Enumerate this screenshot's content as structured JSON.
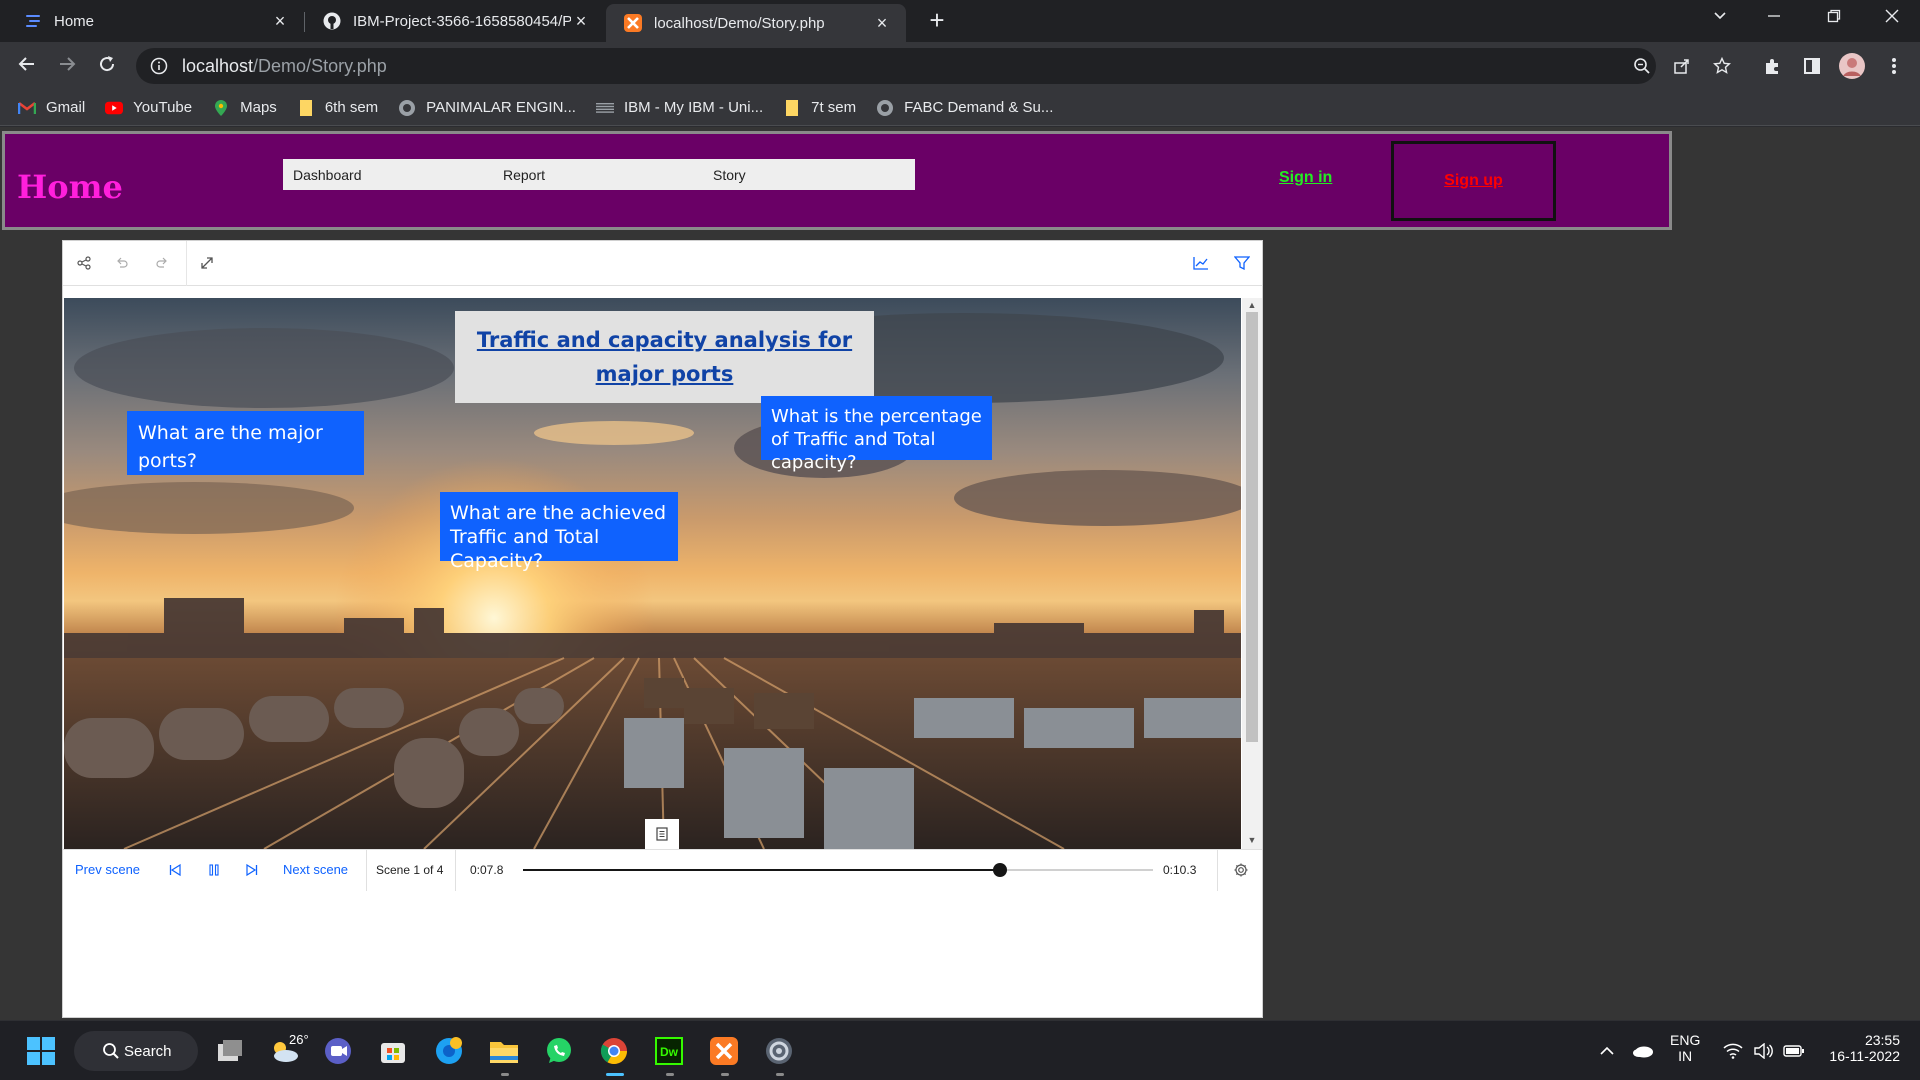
{
  "browser": {
    "tabs": [
      {
        "title": "Home",
        "close": "×"
      },
      {
        "title": "IBM-Project-3566-1658580454/P",
        "close": "×"
      },
      {
        "title": "localhost/Demo/Story.php",
        "close": "×"
      }
    ],
    "new_tab": "+",
    "address": {
      "host": "localhost",
      "path": "/Demo/Story.php"
    },
    "bookmarks": [
      {
        "label": "Gmail"
      },
      {
        "label": "YouTube"
      },
      {
        "label": "Maps"
      },
      {
        "label": "6th sem"
      },
      {
        "label": "PANIMALAR ENGIN..."
      },
      {
        "label": "IBM - My IBM - Uni..."
      },
      {
        "label": "7t sem"
      },
      {
        "label": "FABC Demand & Su..."
      }
    ]
  },
  "site": {
    "brand": "Home",
    "menu": [
      "Dashboard",
      "Report",
      "Story"
    ],
    "signin": "Sign in",
    "signup": "Sign up"
  },
  "story": {
    "title_card": "Traffic and capacity analysis for major ports",
    "questions": [
      "What are the major ports?",
      "What is the percentage of Traffic and Total capacity?",
      "What are the  achieved Traffic and Total Capacity?"
    ],
    "controls": {
      "prev": "Prev scene",
      "next": "Next scene",
      "scene_counter": "Scene 1 of 4",
      "elapsed": "0:07.8",
      "total": "0:10.3",
      "progress_fraction": 0.757
    }
  },
  "taskbar": {
    "search": "Search",
    "weather_temp": "26°",
    "lang_top": "ENG",
    "lang_bottom": "IN",
    "time": "23:55",
    "date": "16-11-2022"
  },
  "colors": {
    "header_bg": "#6a0066",
    "brand": "#ff1fdc",
    "signin": "#22ee22",
    "signup": "#ff0000",
    "question_bg": "#0f62fe",
    "title_link": "#1043a6"
  }
}
